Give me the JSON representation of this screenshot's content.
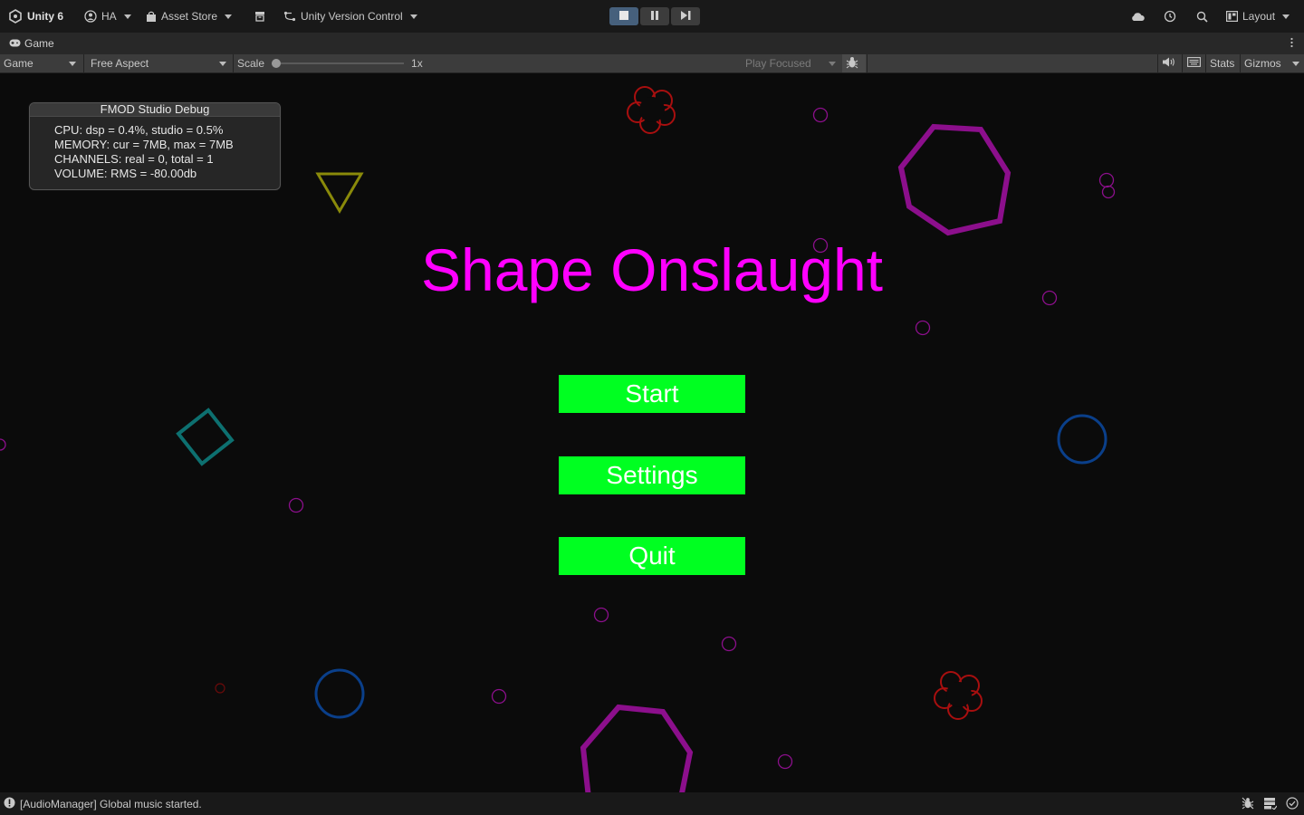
{
  "topbar": {
    "account": "Unity 6",
    "user": "HA",
    "asset_store": "Asset Store",
    "version_control": "Unity Version Control",
    "layout": "Layout"
  },
  "tab": {
    "label": "Game"
  },
  "game_toolbar": {
    "display": "Game",
    "aspect": "Free Aspect",
    "scale_label": "Scale",
    "scale_value": "1x",
    "scale_fraction": 0,
    "play_mode": "Play Focused",
    "stats": "Stats",
    "gizmos": "Gizmos"
  },
  "fmod": {
    "title": "FMOD Studio Debug",
    "lines": [
      "CPU: dsp = 0.4%, studio = 0.5%",
      "MEMORY: cur = 7MB, max = 7MB",
      "CHANNELS: real = 0, total = 1",
      "VOLUME: RMS = -80.00db"
    ]
  },
  "game": {
    "title": "Shape Onslaught",
    "menu": {
      "start": "Start",
      "settings": "Settings",
      "quit": "Quit"
    }
  },
  "status": {
    "message": "[AudioManager] Global music started."
  },
  "colors": {
    "title": "#ff00ff",
    "button": "#00ff21",
    "shape_magenta": "#8c0f8c",
    "shape_red": "#a80f0f",
    "shape_blue": "#0a3f8a",
    "shape_teal": "#0d7070",
    "shape_olive": "#8a8a0a"
  }
}
